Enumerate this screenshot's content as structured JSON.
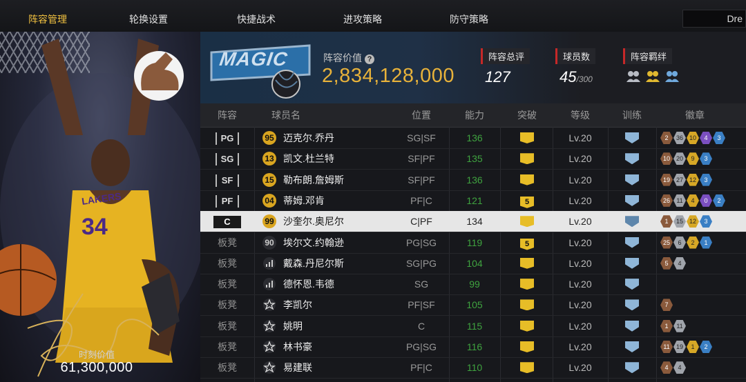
{
  "nav": {
    "tabs": [
      {
        "label": "阵容管理",
        "active": true
      },
      {
        "label": "轮换设置"
      },
      {
        "label": "快捷战术"
      },
      {
        "label": "进攻策略"
      },
      {
        "label": "防守策略"
      }
    ],
    "search_value": "Dre"
  },
  "card": {
    "player_number": "34",
    "jersey_text": "LAKERS",
    "value_label": "时刻价值",
    "value": "61,300,000"
  },
  "team": {
    "logo_text": "MAGIC",
    "value_label": "阵容价值",
    "value": "2,834,128,000",
    "overall_label": "阵容总评",
    "overall": "127",
    "players_label": "球员数",
    "players_count": "45",
    "players_max": "/300",
    "bonds_label": "阵容羁绊",
    "bond_icons": [
      "bond-icon-5",
      "bond-icon-gold",
      "bond-icon-blue"
    ]
  },
  "table": {
    "headers": [
      "阵容",
      "球员名",
      "位置",
      "能力",
      "突破",
      "等级",
      "训练",
      "徽章"
    ],
    "rows": [
      {
        "slot": "PG",
        "bench": false,
        "tier": "95",
        "name": "迈克尔.乔丹",
        "pos": "SG|SF",
        "rating": "136",
        "breakthrough": "crown",
        "level": "Lv.20",
        "badges": [
          [
            "2",
            "bronze"
          ],
          [
            "36",
            "silver"
          ],
          [
            "10",
            "gold"
          ],
          [
            "4",
            "purple"
          ],
          [
            "3",
            "blue"
          ]
        ]
      },
      {
        "slot": "SG",
        "bench": false,
        "tier": "13",
        "name": "凯文.杜兰特",
        "pos": "SF|PF",
        "rating": "135",
        "breakthrough": "crown",
        "level": "Lv.20",
        "badges": [
          [
            "10",
            "bronze"
          ],
          [
            "20",
            "silver"
          ],
          [
            "9",
            "gold"
          ],
          [
            "3",
            "blue"
          ]
        ]
      },
      {
        "slot": "SF",
        "bench": false,
        "tier": "15",
        "name": "勒布朗.詹姆斯",
        "pos": "SF|PF",
        "rating": "136",
        "breakthrough": "crown",
        "level": "Lv.20",
        "badges": [
          [
            "19",
            "bronze"
          ],
          [
            "27",
            "silver"
          ],
          [
            "12",
            "gold"
          ],
          [
            "3",
            "blue"
          ]
        ]
      },
      {
        "slot": "PF",
        "bench": false,
        "tier": "04",
        "name": "蒂姆.邓肯",
        "pos": "PF|C",
        "rating": "121",
        "breakthrough": "5",
        "level": "Lv.20",
        "badges": [
          [
            "26",
            "bronze"
          ],
          [
            "11",
            "silver"
          ],
          [
            "4",
            "gold"
          ],
          [
            "0",
            "purple"
          ],
          [
            "2",
            "blue"
          ]
        ]
      },
      {
        "slot": "C",
        "bench": false,
        "selected": true,
        "tier": "99",
        "name": "沙奎尔.奥尼尔",
        "pos": "C|PF",
        "rating": "134",
        "breakthrough": "crown",
        "level": "Lv.20",
        "badges": [
          [
            "1",
            "bronze"
          ],
          [
            "15",
            "silver"
          ],
          [
            "12",
            "gold"
          ],
          [
            "3",
            "blue"
          ]
        ]
      },
      {
        "slot": "板凳",
        "bench": true,
        "tier": "90",
        "name": "埃尔文.约翰逊",
        "pos": "PG|SG",
        "rating": "119",
        "breakthrough": "5",
        "level": "Lv.20",
        "badges": [
          [
            "25",
            "bronze"
          ],
          [
            "6",
            "silver"
          ],
          [
            "2",
            "gold"
          ],
          [
            "1",
            "blue"
          ]
        ]
      },
      {
        "slot": "板凳",
        "bench": true,
        "tier": "bars",
        "name": "戴森.丹尼尔斯",
        "pos": "SG|PG",
        "rating": "104",
        "breakthrough": "crown",
        "level": "Lv.20",
        "badges": [
          [
            "5",
            "bronze"
          ],
          [
            "4",
            "silver"
          ]
        ]
      },
      {
        "slot": "板凳",
        "bench": true,
        "tier": "bars",
        "name": "德怀恩.韦德",
        "pos": "SG",
        "rating": "99",
        "breakthrough": "crown",
        "level": "Lv.20",
        "badges": []
      },
      {
        "slot": "板凳",
        "bench": true,
        "tier": "star",
        "name": "李凯尔",
        "pos": "PF|SF",
        "rating": "105",
        "breakthrough": "crown",
        "level": "Lv.20",
        "badges": [
          [
            "7",
            "bronze"
          ]
        ]
      },
      {
        "slot": "板凳",
        "bench": true,
        "tier": "star",
        "name": "姚明",
        "pos": "C",
        "rating": "115",
        "breakthrough": "crown",
        "level": "Lv.20",
        "badges": [
          [
            "1",
            "bronze"
          ],
          [
            "11",
            "silver"
          ]
        ]
      },
      {
        "slot": "板凳",
        "bench": true,
        "tier": "star",
        "name": "林书豪",
        "pos": "PG|SG",
        "rating": "116",
        "breakthrough": "crown",
        "level": "Lv.20",
        "badges": [
          [
            "11",
            "bronze"
          ],
          [
            "19",
            "silver"
          ],
          [
            "1",
            "gold"
          ],
          [
            "2",
            "blue"
          ]
        ]
      },
      {
        "slot": "板凳",
        "bench": true,
        "tier": "star",
        "name": "易建联",
        "pos": "PF|C",
        "rating": "110",
        "breakthrough": "crown",
        "level": "Lv.20",
        "badges": [
          [
            "4",
            "bronze"
          ],
          [
            "4",
            "silver"
          ]
        ]
      }
    ]
  }
}
